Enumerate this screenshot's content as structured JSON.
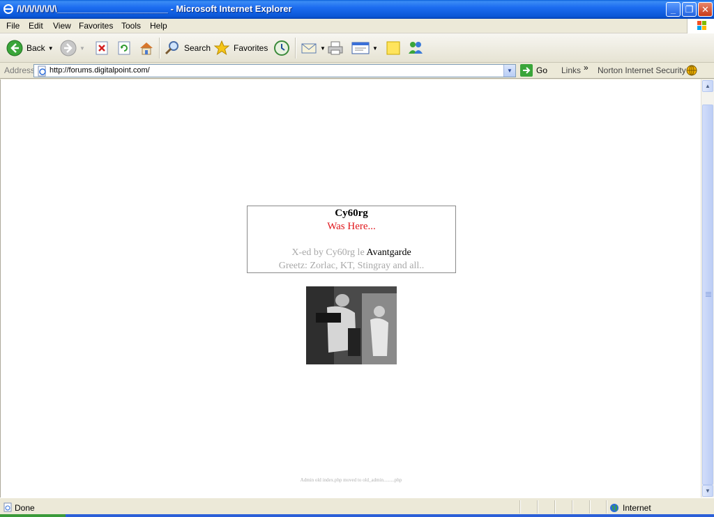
{
  "window": {
    "title": "/\\/\\/\\/\\/\\/\\/\\/\\______________________ - Microsoft Internet Explorer",
    "minimize_label": "_",
    "maximize_label": "❐",
    "close_label": "✕"
  },
  "menu": {
    "file": "File",
    "edit": "Edit",
    "view": "View",
    "favorites": "Favorites",
    "tools": "Tools",
    "help": "Help"
  },
  "toolbar": {
    "back": "Back",
    "search": "Search",
    "favorites": "Favorites"
  },
  "address": {
    "label": "Address",
    "url": "http://forums.digitalpoint.com/",
    "go": "Go",
    "links": "Links",
    "chevron": "»",
    "norton": "Norton Internet Security"
  },
  "page": {
    "heading": "Cy60rg",
    "was_here": "Was Here...",
    "xed_prefix": "X-ed by Cy60rg le ",
    "xed_strong": "Avantgarde",
    "greetz": "Greetz: Zorlac, KT, Stingray and all..",
    "footnote": "Admin old index.php moved to old_admin.........php"
  },
  "status": {
    "text": "Done",
    "zone": "Internet"
  },
  "colors": {
    "title_bar": "#1c6cf0",
    "was_here_red": "#e0161b",
    "muted_text": "#a8a8a8"
  },
  "icons": [
    "ie-icon",
    "back-arrow-icon",
    "forward-arrow-icon",
    "stop-icon",
    "refresh-icon",
    "home-icon",
    "search-icon",
    "favorites-star-icon",
    "history-icon",
    "mail-icon",
    "print-icon",
    "edit-icon",
    "notes-icon",
    "messenger-icon",
    "page-icon",
    "go-arrow-icon",
    "norton-globe-icon",
    "internet-globe-icon",
    "windows-logo-icon"
  ]
}
